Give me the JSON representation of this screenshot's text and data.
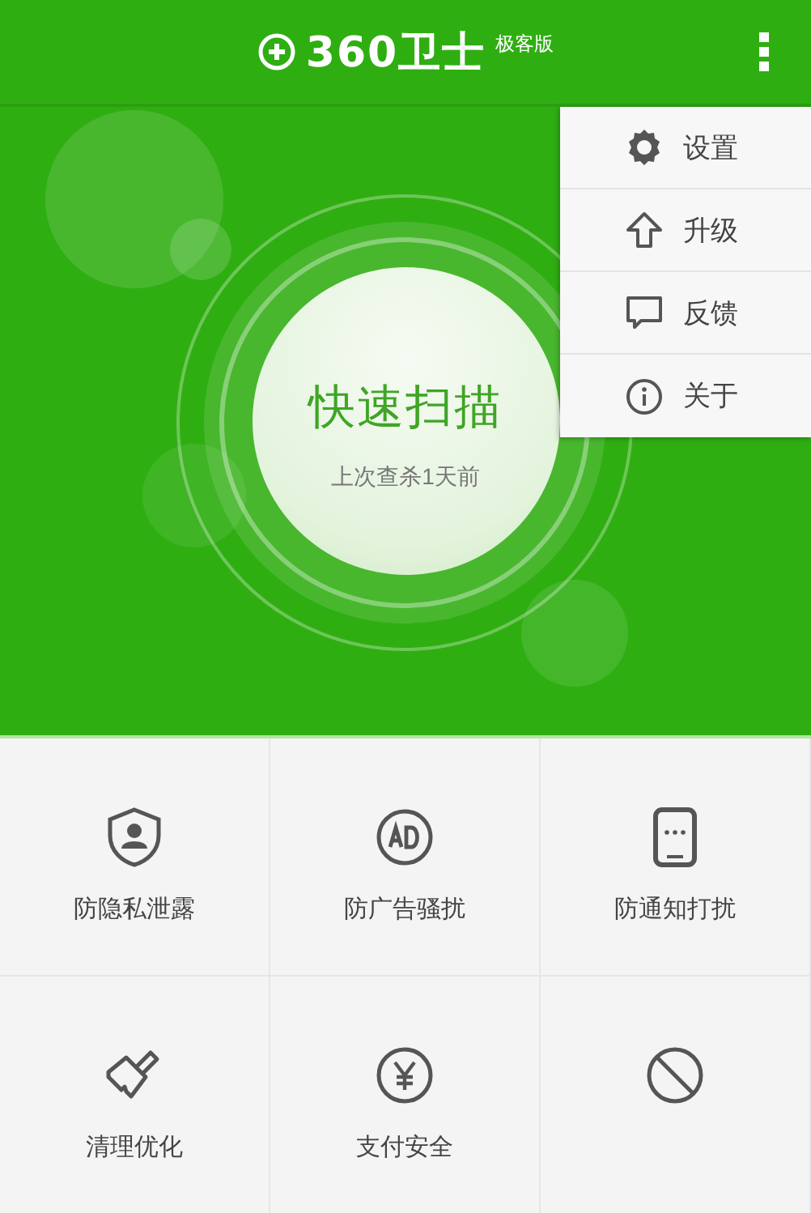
{
  "header": {
    "logo": "360卫士",
    "edition": "极客版"
  },
  "scan": {
    "title": "快速扫描",
    "subtitle": "上次查杀1天前"
  },
  "menu": {
    "items": [
      {
        "label": "设置"
      },
      {
        "label": "升级"
      },
      {
        "label": "反馈"
      },
      {
        "label": "关于"
      }
    ]
  },
  "tiles": [
    {
      "kind": "labeled",
      "label": "防隐私泄露"
    },
    {
      "kind": "labeled",
      "label": "防广告骚扰"
    },
    {
      "kind": "labeled",
      "label": "防通知打扰"
    },
    {
      "kind": "labeled",
      "label": "清理优化"
    },
    {
      "kind": "labeled",
      "label": "支付安全"
    },
    {
      "kind": "icon-only"
    }
  ]
}
